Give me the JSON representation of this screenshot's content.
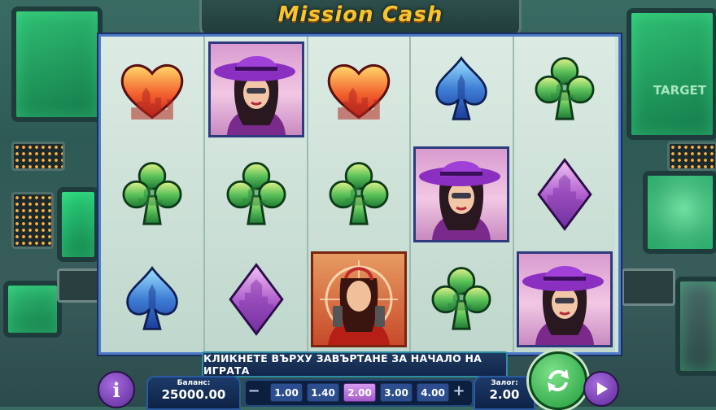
{
  "game": {
    "title": "Mission Cash"
  },
  "background": {
    "target_label": "TARGET"
  },
  "reels": [
    [
      "heart",
      "club",
      "spade"
    ],
    [
      "lady",
      "club",
      "diamond"
    ],
    [
      "heart",
      "club",
      "agent"
    ],
    [
      "spade",
      "lady",
      "club"
    ],
    [
      "club",
      "diamond",
      "lady"
    ]
  ],
  "message": "КЛИКНЕТЕ ВЪРХУ ЗАВЪРТАНЕ ЗА НАЧАЛО НА ИГРАТА",
  "balance": {
    "label": "Баланс:",
    "value": "25000.00"
  },
  "bet": {
    "label": "Залог:",
    "value": "2.00"
  },
  "bet_options": [
    "1.00",
    "1.40",
    "2.00",
    "3.00",
    "4.00"
  ],
  "selected_bet": "2.00",
  "controls": {
    "minus": "−",
    "plus": "+",
    "info": "i"
  },
  "colors": {
    "frame": "#4d7bc9",
    "spin_green": "#1f9a3a",
    "selected_chip": "#a05ac8"
  }
}
